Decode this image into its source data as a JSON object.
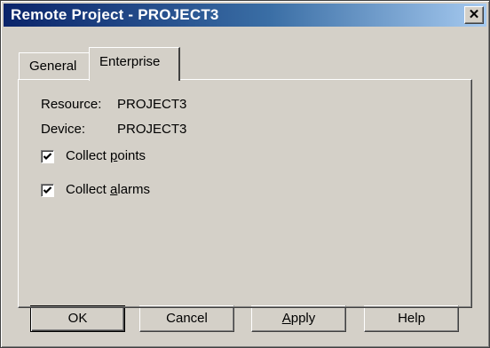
{
  "window": {
    "title": "Remote Project - PROJECT3",
    "close_symbol": "✕",
    "close_icon": "close-icon"
  },
  "tabs": [
    {
      "label": "General",
      "active": false
    },
    {
      "label": "Enterprise",
      "active": true
    }
  ],
  "enterprise": {
    "resource_label": "Resource:",
    "resource_value": "PROJECT3",
    "device_label": "Device:",
    "device_value": "PROJECT3",
    "collect_points": {
      "pre": "Collect ",
      "accel": "p",
      "post": "oints",
      "checked": true
    },
    "collect_alarms": {
      "pre": "Collect ",
      "accel": "a",
      "post": "larms",
      "checked": true
    }
  },
  "buttons": {
    "ok": "OK",
    "cancel": "Cancel",
    "apply_accel": "A",
    "apply_rest": "pply",
    "help": "Help"
  },
  "colors": {
    "face": "#d4d0c8",
    "title_start": "#0a246a",
    "title_end": "#a6caf0"
  }
}
